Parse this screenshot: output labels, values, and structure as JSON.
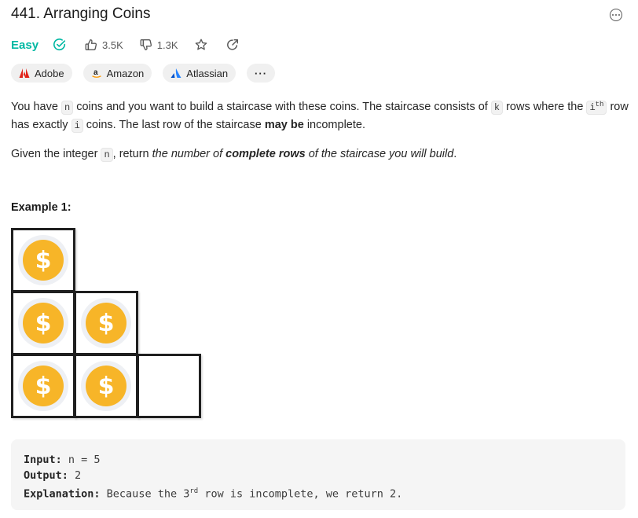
{
  "problem": {
    "title": "441. Arranging Coins",
    "difficulty": "Easy",
    "likes": "3.5K",
    "dislikes": "1.3K",
    "accent_easy": "#00b8a3"
  },
  "icons": {
    "more": "more-horizontal-circle-icon",
    "solved": "check-circle-icon",
    "like": "thumbs-up-icon",
    "dislike": "thumbs-down-icon",
    "favorite": "star-icon",
    "share": "share-icon"
  },
  "tags": [
    {
      "label": "Adobe",
      "logo": "adobe-logo-icon"
    },
    {
      "label": "Amazon",
      "logo": "amazon-logo-icon"
    },
    {
      "label": "Atlassian",
      "logo": "atlassian-logo-icon"
    },
    {
      "label": "···",
      "logo": ""
    }
  ],
  "description": {
    "p1_a": "You have ",
    "code_n": "n",
    "p1_b": " coins and you want to build a staircase with these coins. The staircase consists of ",
    "code_k": "k",
    "p1_c": " rows where the ",
    "code_i": "i",
    "code_th": "th",
    "p1_d": " row has exactly ",
    "code_i2": "i",
    "p1_e": " coins. The last row of the staircase ",
    "bold_maybe": "may be",
    "p1_f": " incomplete.",
    "p2_a": "Given the integer ",
    "p2_b": ", return ",
    "p2_c": "the number of ",
    "p2_bold": "complete rows",
    "p2_d": " of the staircase you will build",
    "p2_end": "."
  },
  "example": {
    "title": "Example 1:",
    "coin_symbol": "$",
    "input_label": "Input:",
    "input_value": " n = 5",
    "output_label": "Output:",
    "output_value": " 2",
    "explanation_label": "Explanation:",
    "explanation_a": " Because the 3",
    "explanation_sup": "rd",
    "explanation_b": " row is incomplete, we return 2."
  }
}
